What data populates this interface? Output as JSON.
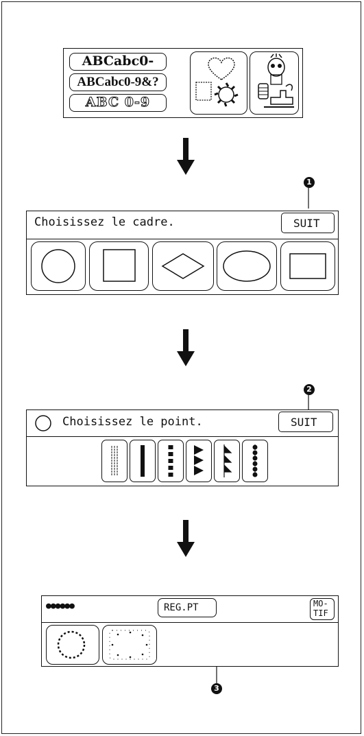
{
  "screen1": {
    "font_buttons": [
      "ABCabc0-9&?",
      "ABCabc0-9&?",
      "ABC 0-9"
    ],
    "motif_icons": [
      "heart-square-sun-icon",
      "sewing-machine-character-icon"
    ]
  },
  "screen2": {
    "prompt": "Choisissez le cadre.",
    "next_label": "SUIT",
    "callout": "1",
    "frames": [
      "circle-frame",
      "square-frame",
      "diamond-frame",
      "oval-frame",
      "rectangle-frame"
    ]
  },
  "screen3": {
    "prompt": "Choisissez le point.",
    "next_label": "SUIT",
    "callout": "2",
    "stitches": [
      "triple-straight-stitch",
      "satin-stitch",
      "dashed-satin-stitch",
      "triangle-stitch",
      "sawtooth-stitch",
      "dot-stitch"
    ]
  },
  "screen4": {
    "stitch_preview": "●●●●●●",
    "reg_label": "REG.PT",
    "motif_label_1": "MO-",
    "motif_label_2": "TIF",
    "callout": "3",
    "patterns": [
      "dotted-circle-pattern",
      "scattered-dot-square-pattern"
    ]
  }
}
